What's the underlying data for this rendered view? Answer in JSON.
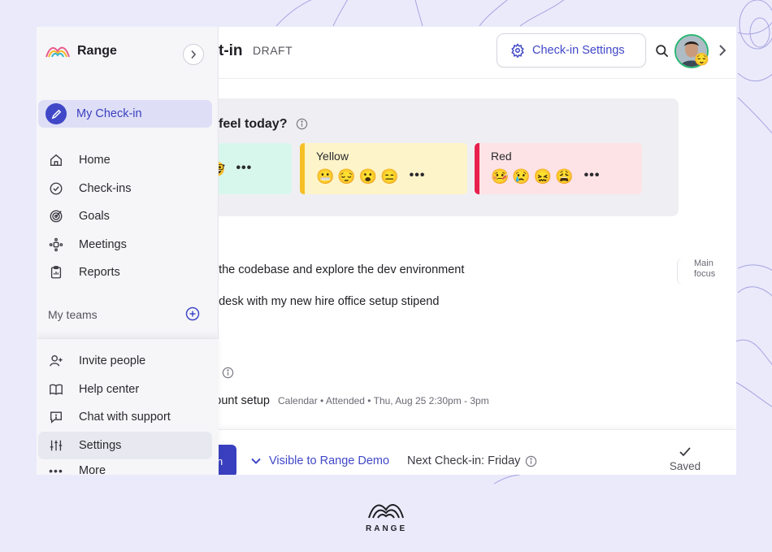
{
  "app": {
    "brand_name": "Range",
    "footer_logo_text": "RANGE",
    "accent_color": "#4048c8",
    "page_title": "t-in",
    "page_status": "DRAFT"
  },
  "topbar": {
    "settings_label": "Check-in Settings",
    "avatar_emoji": "😌"
  },
  "sidebar": {
    "my_checkin": "My Check-in",
    "nav": [
      {
        "label": "Home",
        "icon": "home-icon"
      },
      {
        "label": "Check-ins",
        "icon": "check-circle-icon"
      },
      {
        "label": "Goals",
        "icon": "target-icon"
      },
      {
        "label": "Meetings",
        "icon": "meetings-icon"
      },
      {
        "label": "Reports",
        "icon": "clipboard-icon"
      }
    ],
    "teams_label": "My teams",
    "bottom": [
      {
        "label": "Invite people",
        "icon": "add-person-icon"
      },
      {
        "label": "Help center",
        "icon": "book-icon"
      },
      {
        "label": "Chat with support",
        "icon": "chat-icon"
      },
      {
        "label": "Settings",
        "icon": "sliders-icon"
      },
      {
        "label": "More",
        "icon": "more-icon"
      }
    ]
  },
  "mood": {
    "question": "feel today?",
    "green": {
      "emojis": "🤓",
      "more": "•••"
    },
    "yellow": {
      "name": "Yellow",
      "emojis": "😬😔😮😑",
      "more": "•••",
      "color": "#f5c025"
    },
    "red": {
      "name": "Red",
      "emojis": "🤒😢😖😩",
      "more": "•••",
      "color": "#e8204d"
    }
  },
  "items": {
    "line1": "h the codebase and explore the dev environment",
    "line1_badge_1": "Main",
    "line1_badge_2": "focus",
    "line2": "g desk with my new hire office setup stipend",
    "line3": "count setup",
    "line3_meta": "Calendar • Attended • Thu, Aug 25 2:30pm - 3pm"
  },
  "footer": {
    "submit_label": "n",
    "visibility": "Visible to Range Demo",
    "next_checkin": "Next Check-in: Friday",
    "saved": "Saved"
  }
}
